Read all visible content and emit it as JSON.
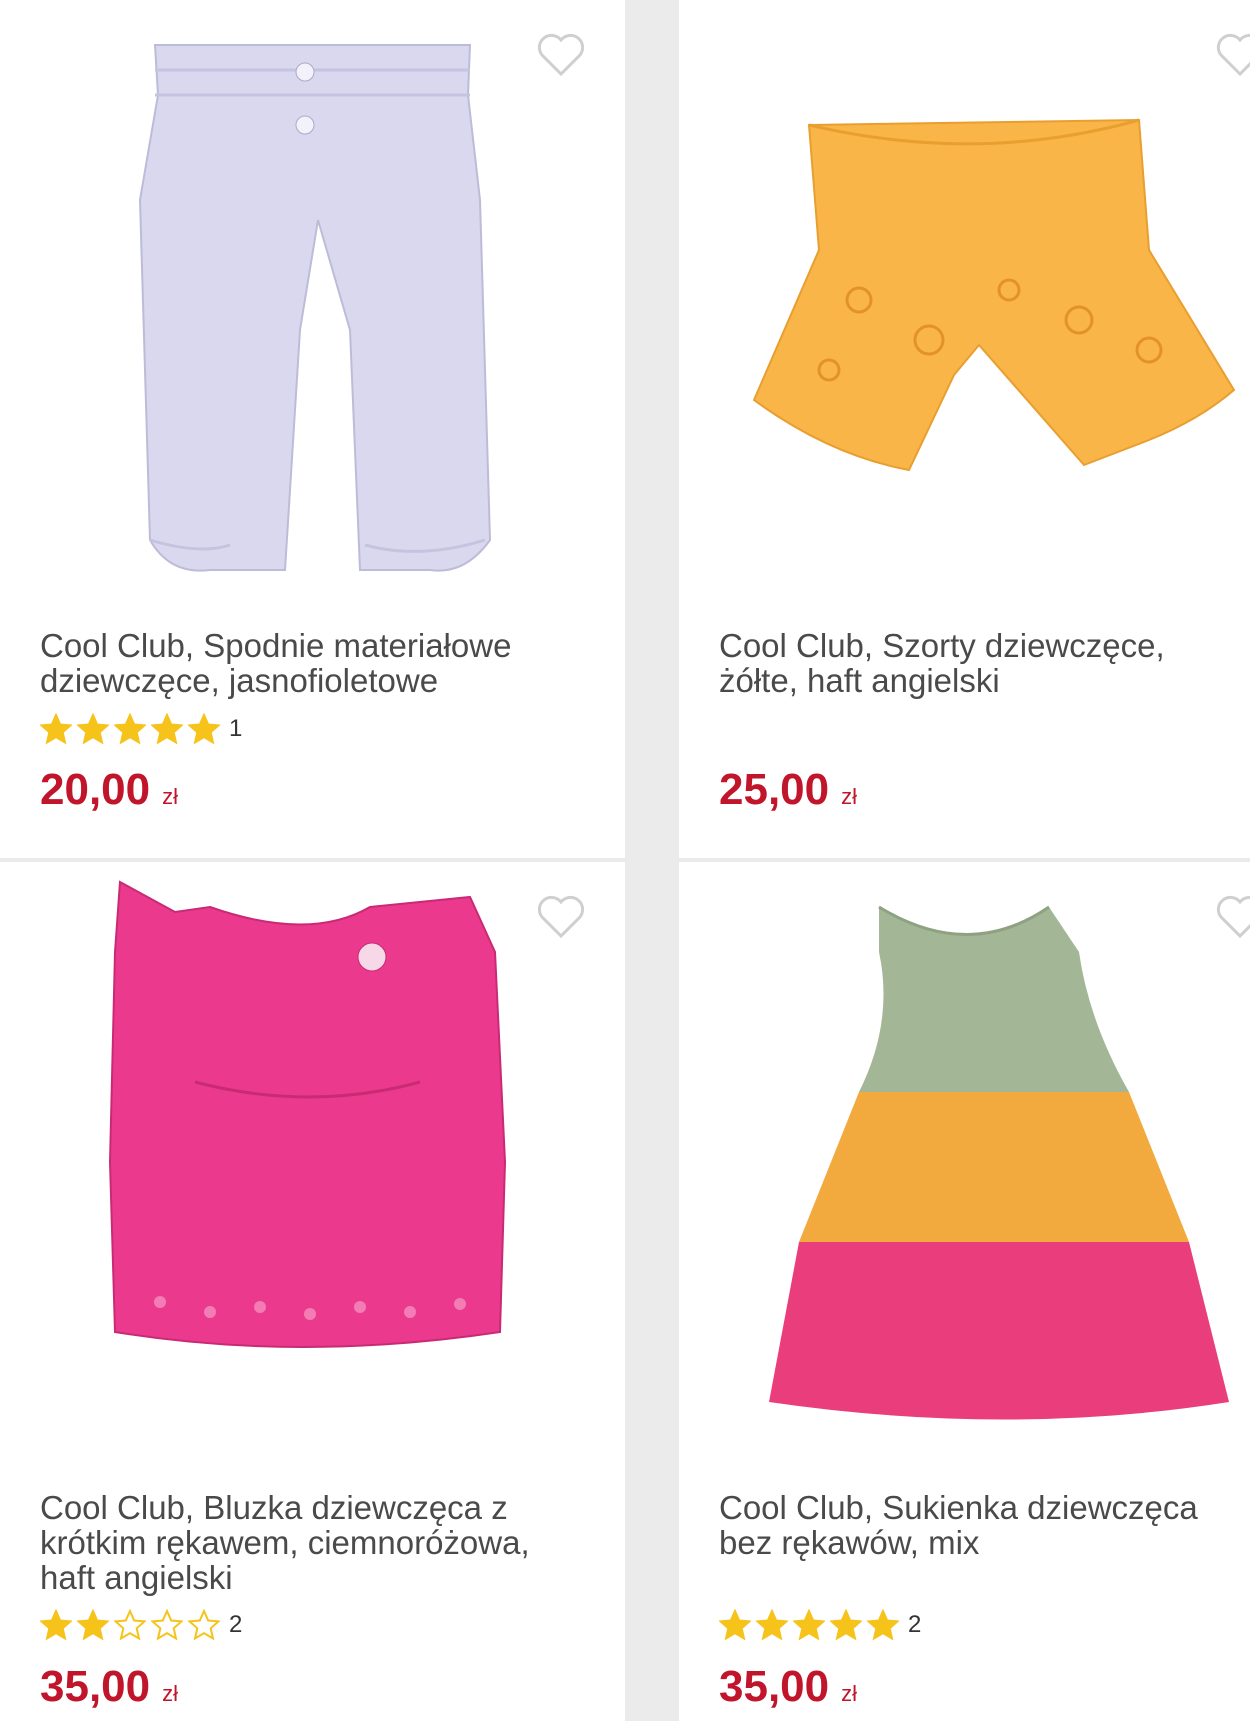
{
  "products": [
    {
      "title": "Cool Club, Spodnie materiałowe dziewczęce, jasnofioletowe",
      "rating": 5,
      "rating_count": "1",
      "price": "20,00",
      "currency": "zł",
      "color": "#d9d8ef"
    },
    {
      "title": "Cool Club, Szorty dziewczęce, żółte, haft angielski",
      "rating": null,
      "rating_count": "",
      "price": "25,00",
      "currency": "zł",
      "color": "#f9b548"
    },
    {
      "title": "Cool Club, Bluzka dziewczęca z krótkim rękawem, ciemnoróżowa, haft angielski",
      "rating": 2,
      "rating_count": "2",
      "price": "35,00",
      "currency": "zł",
      "color": "#eb3a8e"
    },
    {
      "title": "Cool Club, Sukienka dziewczęca bez rękawów, mix",
      "rating": 5,
      "rating_count": "2",
      "price": "35,00",
      "currency": "zł",
      "color": "#f2a93e"
    }
  ],
  "colors": {
    "price": "#c0152a",
    "star": "#f6c31b",
    "background": "#ebebeb"
  },
  "icons": {
    "favorite": "heart-outline-icon",
    "star_full": "star-filled-icon",
    "star_empty": "star-outline-icon"
  }
}
